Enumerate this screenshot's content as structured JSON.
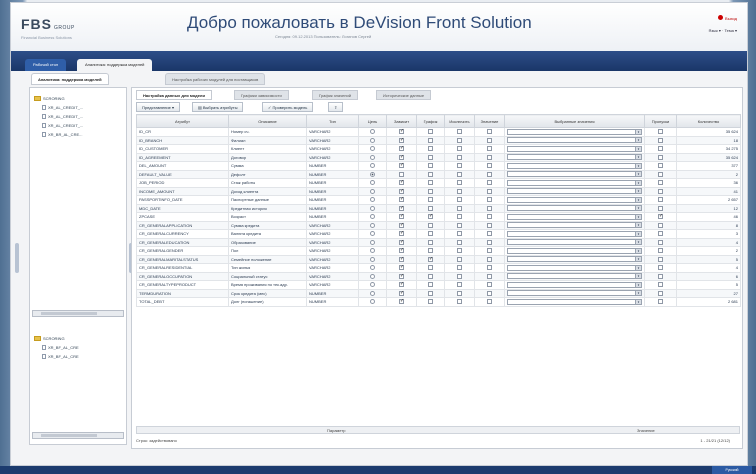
{
  "header": {
    "logo_main": "FBS",
    "logo_sub": "GROUP",
    "logo_tag": "Financial Business Solutions",
    "welcome": "Добро пожаловать в DeVision Front Solution",
    "user_info": "Сегодня: 09.12.2013   Пользователь: Логинов Сергей",
    "exit_label": "Выход",
    "lang_label": "Язык ▾ · Тема ▾"
  },
  "nav": {
    "tabs": [
      "Рабочий стол",
      "Аналитика: поддержка моделей"
    ]
  },
  "subtabs": [
    "Аналитика: поддержка моделей",
    "Настройка рабочих модулей для поставщиков"
  ],
  "left": {
    "tree1": [
      "SCRORING",
      "XR_AL_CREDIT_...",
      "XR_AL_CREDIT_...",
      "XR_AL_CREDIT_...",
      "XR_BR_AL_CRE..."
    ],
    "tree2": [
      "SCRORING",
      "XR_BF_AL_CRE",
      "XR_BF_AL_CRE"
    ]
  },
  "main": {
    "tabs": [
      "Настройка данных для модели",
      "Графики зависимости",
      "График значений",
      "Исторические данные"
    ],
    "toolbar": [
      "Представление ▾",
      "Выбрать атрибуты",
      "Проверить модель"
    ],
    "columns": [
      "Атрибут",
      "Описание",
      "Тип",
      "Цель",
      "Зависит",
      "График",
      "Исключить",
      "Значение",
      "Выбранные значения",
      "Пропуски",
      "Количество"
    ],
    "rows": [
      {
        "a": "ID_CR",
        "d": "Номер сч.",
        "t": "VARCHAR2",
        "goal": false,
        "dep": true,
        "gr": false,
        "ex": false,
        "val": false,
        "miss": false,
        "n": "35 624"
      },
      {
        "a": "ID_BRANCH",
        "d": "Филиал",
        "t": "VARCHAR2",
        "goal": false,
        "dep": true,
        "gr": false,
        "ex": false,
        "val": false,
        "miss": false,
        "n": "18"
      },
      {
        "a": "ID_CUSTOMER",
        "d": "Клиент",
        "t": "VARCHAR2",
        "goal": false,
        "dep": true,
        "gr": false,
        "ex": false,
        "val": false,
        "miss": false,
        "n": "34 275"
      },
      {
        "a": "ID_AGREEMENT",
        "d": "Договор",
        "t": "VARCHAR2",
        "goal": false,
        "dep": true,
        "gr": false,
        "ex": false,
        "val": false,
        "miss": false,
        "n": "35 624"
      },
      {
        "a": "DEL_AMOUNT",
        "d": "Сумма",
        "t": "NUMBER",
        "goal": false,
        "dep": true,
        "gr": false,
        "ex": false,
        "val": false,
        "miss": false,
        "n": "377"
      },
      {
        "a": "DEFAULT_VALUE",
        "d": "Дефолт",
        "t": "NUMBER",
        "goal": true,
        "dep": false,
        "gr": false,
        "ex": false,
        "val": false,
        "miss": false,
        "n": "2"
      },
      {
        "a": "JOB_PERIOD",
        "d": "Стаж работы",
        "t": "NUMBER",
        "goal": false,
        "dep": true,
        "gr": false,
        "ex": false,
        "val": false,
        "miss": false,
        "n": "36"
      },
      {
        "a": "INCOME_AMOUNT",
        "d": "Доход клиента",
        "t": "NUMBER",
        "goal": false,
        "dep": true,
        "gr": false,
        "ex": false,
        "val": false,
        "miss": false,
        "n": "41"
      },
      {
        "a": "PASSPORTINFO_DATE",
        "d": "Паспортные данные",
        "t": "NUMBER",
        "goal": false,
        "dep": true,
        "gr": false,
        "ex": false,
        "val": false,
        "miss": false,
        "n": "2 657"
      },
      {
        "a": "MDC_DATE",
        "d": "Кредитная история",
        "t": "NUMBER",
        "goal": false,
        "dep": true,
        "gr": false,
        "ex": false,
        "val": false,
        "miss": false,
        "n": "12"
      },
      {
        "a": "ZPCASE",
        "d": "Возраст",
        "t": "NUMBER",
        "goal": false,
        "dep": true,
        "gr": true,
        "ex": false,
        "val": false,
        "miss": true,
        "n": "46"
      },
      {
        "a": "CR_GENERALAPPLICATION",
        "d": "Сумма кредита",
        "t": "VARCHAR2",
        "goal": false,
        "dep": true,
        "gr": false,
        "ex": false,
        "val": false,
        "miss": false,
        "n": "8"
      },
      {
        "a": "CR_GENERALCURRENCY",
        "d": "Валюта кредита",
        "t": "VARCHAR2",
        "goal": false,
        "dep": true,
        "gr": false,
        "ex": false,
        "val": false,
        "miss": false,
        "n": "3"
      },
      {
        "a": "CR_GENERALEDUCATION",
        "d": "Образование",
        "t": "VARCHAR2",
        "goal": false,
        "dep": true,
        "gr": false,
        "ex": false,
        "val": false,
        "miss": false,
        "n": "4"
      },
      {
        "a": "CR_GENERALGENDER",
        "d": "Пол",
        "t": "VARCHAR2",
        "goal": false,
        "dep": true,
        "gr": false,
        "ex": false,
        "val": false,
        "miss": false,
        "n": "2"
      },
      {
        "a": "CR_GENERALMARITALSTATUS",
        "d": "Семейное положение",
        "t": "VARCHAR2",
        "goal": false,
        "dep": true,
        "gr": true,
        "ex": false,
        "val": false,
        "miss": false,
        "n": "5"
      },
      {
        "a": "CR_GENERALRESIDENTIAL",
        "d": "Тип жилья",
        "t": "VARCHAR2",
        "goal": false,
        "dep": true,
        "gr": false,
        "ex": false,
        "val": false,
        "miss": false,
        "n": "4"
      },
      {
        "a": "CR_GENERALOCCUPATION",
        "d": "Социальный статус",
        "t": "VARCHAR2",
        "goal": false,
        "dep": true,
        "gr": false,
        "ex": false,
        "val": false,
        "miss": false,
        "n": "6"
      },
      {
        "a": "CR_GENERALTYPEPRODUCT",
        "d": "Время проживания по тек.адр.",
        "t": "VARCHAR2",
        "goal": false,
        "dep": true,
        "gr": false,
        "ex": false,
        "val": false,
        "miss": false,
        "n": "5"
      },
      {
        "a": "TERMDURATION",
        "d": "Срок кредита (мес)",
        "t": "NUMBER",
        "goal": false,
        "dep": true,
        "gr": false,
        "ex": false,
        "val": false,
        "miss": false,
        "n": "27"
      },
      {
        "a": "TOTAL_DEBT",
        "d": "Долг (погашение)",
        "t": "NUMBER",
        "goal": false,
        "dep": true,
        "gr": false,
        "ex": false,
        "val": false,
        "miss": false,
        "n": "2 681"
      }
    ],
    "footer_col1": "Параметр",
    "footer_col2": "Значение",
    "status_left": "Строк: задействовано",
    "status_right": "1 - 21/21 (12/12)"
  },
  "taskbar": {
    "tray": "Русский"
  }
}
